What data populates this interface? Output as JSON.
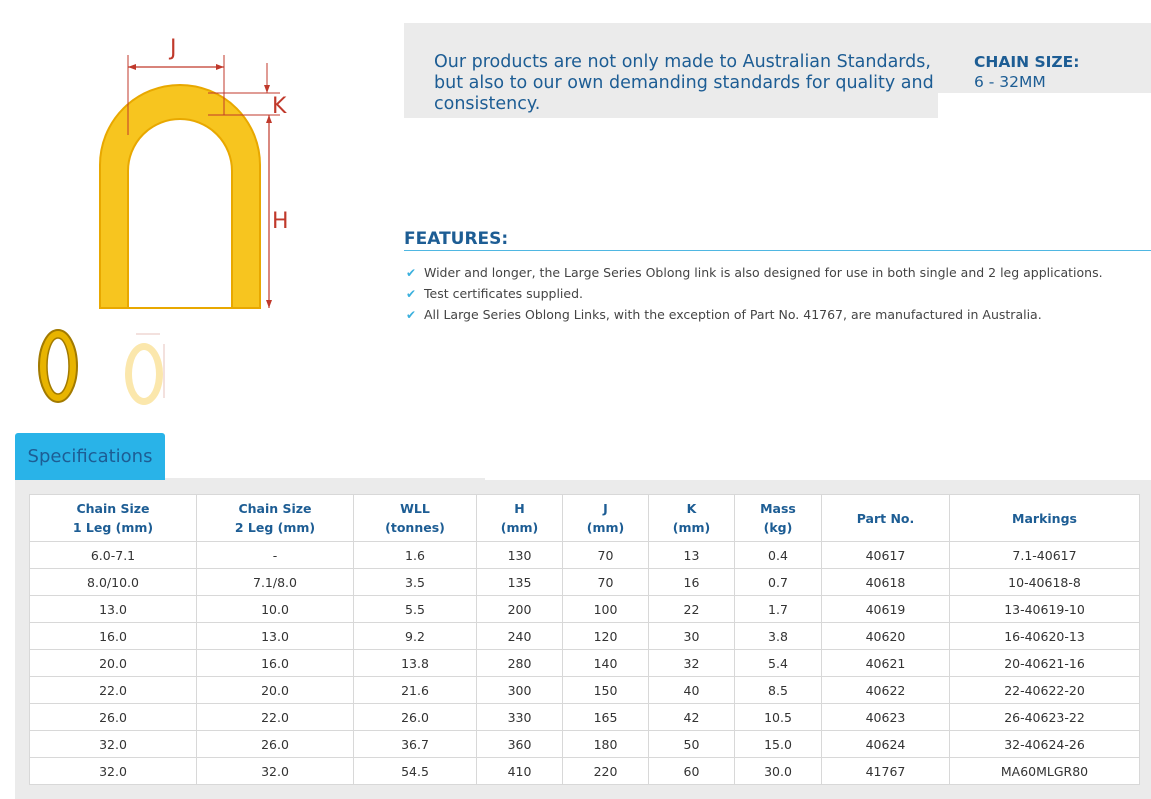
{
  "diagram": {
    "label_j": "J",
    "label_k": "K",
    "label_h": "H"
  },
  "thumbnails": [
    "oblong-link-photo",
    "oblong-link-diagram"
  ],
  "intro": {
    "text": "Our products are not only made to Australian Standards, but also to our own demanding standards for quality and consistency.",
    "chain_size_label": "CHAIN SIZE:",
    "chain_size_value": "6 - 32MM"
  },
  "features": {
    "title": "FEATURES:",
    "items": [
      "Wider and longer, the Large Series Oblong link is also designed for use in both single and 2 leg applications.",
      "Test certificates supplied.",
      "All Large Series Oblong Links, with the exception of Part No. 41767, are manufactured in Australia."
    ]
  },
  "specifications": {
    "tab_label": "Specifications",
    "headers": [
      [
        "Chain Size",
        "1 Leg (mm)"
      ],
      [
        "Chain Size",
        "2 Leg (mm)"
      ],
      [
        "WLL",
        "(tonnes)"
      ],
      [
        "H",
        "(mm)"
      ],
      [
        "J",
        "(mm)"
      ],
      [
        "K",
        "(mm)"
      ],
      [
        "Mass",
        "(kg)"
      ],
      [
        "Part No.",
        ""
      ],
      [
        "Markings",
        ""
      ]
    ],
    "rows": [
      [
        "6.0-7.1",
        "-",
        "1.6",
        "130",
        "70",
        "13",
        "0.4",
        "40617",
        "7.1-40617"
      ],
      [
        "8.0/10.0",
        "7.1/8.0",
        "3.5",
        "135",
        "70",
        "16",
        "0.7",
        "40618",
        "10-40618-8"
      ],
      [
        "13.0",
        "10.0",
        "5.5",
        "200",
        "100",
        "22",
        "1.7",
        "40619",
        "13-40619-10"
      ],
      [
        "16.0",
        "13.0",
        "9.2",
        "240",
        "120",
        "30",
        "3.8",
        "40620",
        "16-40620-13"
      ],
      [
        "20.0",
        "16.0",
        "13.8",
        "280",
        "140",
        "32",
        "5.4",
        "40621",
        "20-40621-16"
      ],
      [
        "22.0",
        "20.0",
        "21.6",
        "300",
        "150",
        "40",
        "8.5",
        "40622",
        "22-40622-20"
      ],
      [
        "26.0",
        "22.0",
        "26.0",
        "330",
        "165",
        "42",
        "10.5",
        "40623",
        "26-40623-22"
      ],
      [
        "32.0",
        "26.0",
        "36.7",
        "360",
        "180",
        "50",
        "15.0",
        "40624",
        "32-40624-26"
      ],
      [
        "32.0",
        "32.0",
        "54.5",
        "410",
        "220",
        "60",
        "30.0",
        "41767",
        "MA60MLGR80"
      ]
    ]
  },
  "colors": {
    "link_yellow": "#f7c51f",
    "link_outline": "#e8a800",
    "dimension_red": "#c0392b",
    "heading_blue": "#1d5d94",
    "tab_blue": "#29b3e8",
    "check_blue": "#3ab0dd",
    "panel_grey": "#ebebeb"
  }
}
